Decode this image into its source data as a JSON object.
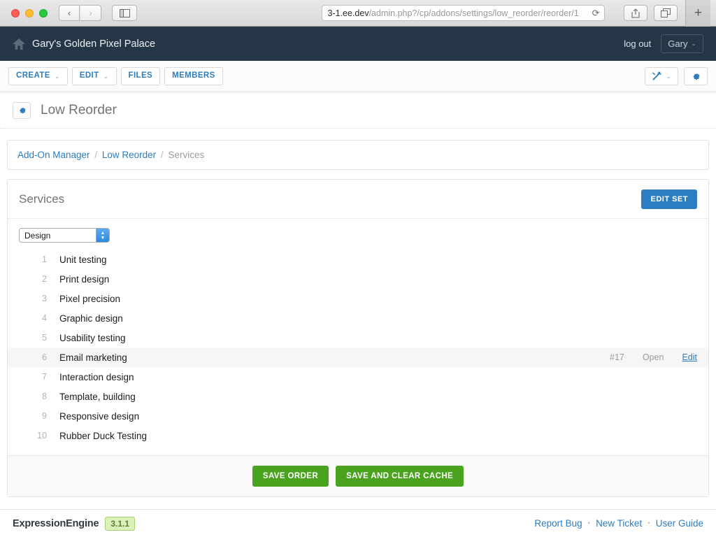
{
  "browser": {
    "back_icon": "‹",
    "forward_icon": "›",
    "sidebar_icon": "sidebar",
    "shield_icon": "①",
    "url_domain": "3-1.ee.dev",
    "url_path": "/admin.php?/cp/addons/settings/low_reorder/reorder/1",
    "reload_icon": "⟳",
    "share_icon": "⇧",
    "tabs_icon": "❐",
    "newtab_icon": "+"
  },
  "header": {
    "home_icon": "home-icon",
    "site_name": "Gary's Golden Pixel Palace",
    "logout_label": "log out",
    "user_label": "Gary",
    "user_caret": "⌄"
  },
  "toolbar": {
    "items": [
      {
        "label": "CREATE",
        "caret": "⌄"
      },
      {
        "label": "EDIT",
        "caret": "⌄"
      },
      {
        "label": "FILES",
        "caret": ""
      },
      {
        "label": "MEMBERS",
        "caret": ""
      }
    ],
    "tools_caret": "⌄"
  },
  "page": {
    "title": "Low Reorder",
    "title_icon": "gear-icon"
  },
  "breadcrumb": {
    "items": [
      {
        "label": "Add-On Manager",
        "link": true
      },
      {
        "label": "Low Reorder",
        "link": true
      },
      {
        "label": "Services",
        "link": false
      }
    ],
    "separator": "/"
  },
  "panel": {
    "title": "Services",
    "edit_set_label": "EDIT SET",
    "select": {
      "value": "Design",
      "options": [
        "Design"
      ]
    },
    "rows": [
      {
        "num": "1",
        "label": "Unit testing",
        "id": "",
        "status": "",
        "edit": ""
      },
      {
        "num": "2",
        "label": "Print design",
        "id": "",
        "status": "",
        "edit": ""
      },
      {
        "num": "3",
        "label": "Pixel precision",
        "id": "",
        "status": "",
        "edit": ""
      },
      {
        "num": "4",
        "label": "Graphic design",
        "id": "",
        "status": "",
        "edit": ""
      },
      {
        "num": "5",
        "label": "Usability testing",
        "id": "",
        "status": "",
        "edit": ""
      },
      {
        "num": "6",
        "label": "Email marketing",
        "id": "#17",
        "status": "Open",
        "edit": "Edit",
        "active": true
      },
      {
        "num": "7",
        "label": "Interaction design",
        "id": "",
        "status": "",
        "edit": ""
      },
      {
        "num": "8",
        "label": "Template, building",
        "id": "",
        "status": "",
        "edit": ""
      },
      {
        "num": "9",
        "label": "Responsive design",
        "id": "",
        "status": "",
        "edit": ""
      },
      {
        "num": "10",
        "label": "Rubber Duck Testing",
        "id": "",
        "status": "",
        "edit": ""
      }
    ],
    "save_order_label": "SAVE ORDER",
    "save_clear_label": "SAVE AND CLEAR CACHE"
  },
  "footer": {
    "brand": "ExpressionEngine",
    "version": "3.1.1",
    "links": [
      "Report Bug",
      "New Ticket",
      "User Guide"
    ],
    "separator": "•"
  },
  "colors": {
    "header_bg": "#253746",
    "accent_blue": "#2c7dbf",
    "button_blue": "#2b7ec1",
    "button_green": "#4aa31f",
    "badge_green_bg": "#dcf0bc"
  }
}
